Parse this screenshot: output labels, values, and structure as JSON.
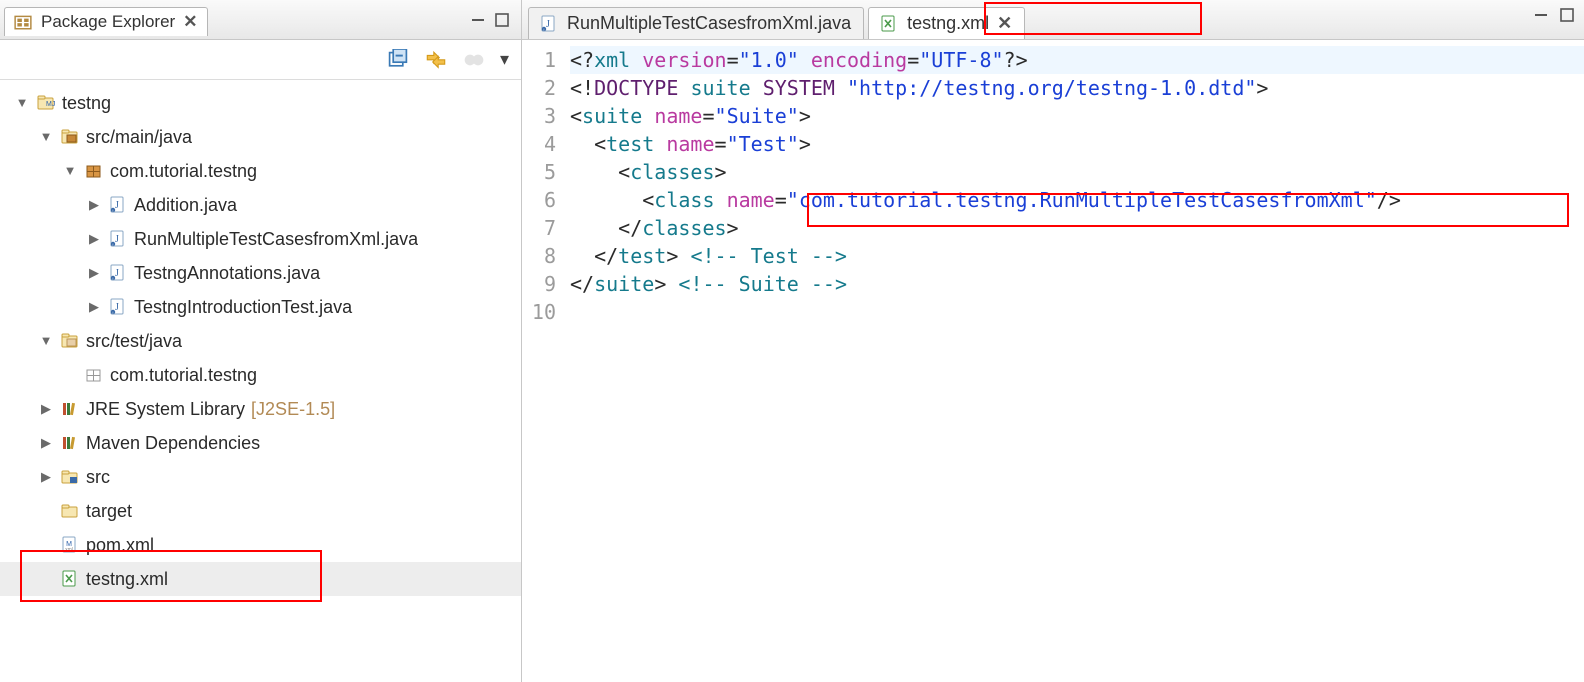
{
  "explorer": {
    "title": "Package Explorer",
    "nodes": [
      {
        "indent": 0,
        "twisty": "down",
        "icon": "project",
        "label": "testng",
        "sel": false
      },
      {
        "indent": 1,
        "twisty": "down",
        "icon": "srcfolder",
        "label": "src/main/java",
        "sel": false
      },
      {
        "indent": 2,
        "twisty": "down",
        "icon": "package",
        "label": "com.tutorial.testng",
        "sel": false
      },
      {
        "indent": 3,
        "twisty": "right",
        "icon": "java",
        "label": "Addition.java",
        "sel": false
      },
      {
        "indent": 3,
        "twisty": "right",
        "icon": "java",
        "label": "RunMultipleTestCasesfromXml.java",
        "sel": false,
        "clip": true
      },
      {
        "indent": 3,
        "twisty": "right",
        "icon": "java",
        "label": "TestngAnnotations.java",
        "sel": false
      },
      {
        "indent": 3,
        "twisty": "right",
        "icon": "java",
        "label": "TestngIntroductionTest.java",
        "sel": false
      },
      {
        "indent": 1,
        "twisty": "down",
        "icon": "srcfolder-w",
        "label": "src/test/java",
        "sel": false
      },
      {
        "indent": 2,
        "twisty": "blank",
        "icon": "package-e",
        "label": "com.tutorial.testng",
        "sel": false
      },
      {
        "indent": 1,
        "twisty": "right",
        "icon": "library",
        "label": "JRE System Library",
        "suffix": "[J2SE-1.5]",
        "sel": false
      },
      {
        "indent": 1,
        "twisty": "right",
        "icon": "library",
        "label": "Maven Dependencies",
        "sel": false
      },
      {
        "indent": 1,
        "twisty": "right",
        "icon": "folder-s",
        "label": "src",
        "sel": false
      },
      {
        "indent": 1,
        "twisty": "blank",
        "icon": "folder",
        "label": "target",
        "sel": false
      },
      {
        "indent": 1,
        "twisty": "blank",
        "icon": "xml-m",
        "label": "pom.xml",
        "sel": false
      },
      {
        "indent": 1,
        "twisty": "blank",
        "icon": "xml-g",
        "label": "testng.xml",
        "sel": true
      }
    ]
  },
  "editor": {
    "tabs": [
      {
        "icon": "java",
        "label": "RunMultipleTestCasesfromXml.java",
        "active": false
      },
      {
        "icon": "xml-g",
        "label": "testng.xml",
        "active": true
      }
    ],
    "code": [
      {
        "n": 1,
        "hl": true,
        "tokens": [
          [
            "t",
            "<?"
          ],
          [
            "pi",
            "xml"
          ],
          [
            "t",
            " "
          ],
          [
            "attr",
            "version"
          ],
          [
            "t",
            "="
          ],
          [
            "str",
            "\"1.0\""
          ],
          [
            "t",
            " "
          ],
          [
            "attr",
            "encoding"
          ],
          [
            "t",
            "="
          ],
          [
            "str",
            "\"UTF-8\""
          ],
          [
            "t",
            "?>"
          ]
        ]
      },
      {
        "n": 2,
        "tokens": [
          [
            "t",
            "<!"
          ],
          [
            "kw",
            "DOCTYPE"
          ],
          [
            "t",
            " "
          ],
          [
            "tag",
            "suite"
          ],
          [
            "t",
            " "
          ],
          [
            "kw",
            "SYSTEM"
          ],
          [
            "t",
            " "
          ],
          [
            "str",
            "\"http://testng.org/testng-1.0.dtd\""
          ],
          [
            "t",
            ">"
          ]
        ]
      },
      {
        "n": 3,
        "tokens": [
          [
            "t",
            "<"
          ],
          [
            "tag",
            "suite"
          ],
          [
            "t",
            " "
          ],
          [
            "attr",
            "name"
          ],
          [
            "t",
            "="
          ],
          [
            "str",
            "\"Suite\""
          ],
          [
            "t",
            ">"
          ]
        ]
      },
      {
        "n": 4,
        "tokens": [
          [
            "t",
            "  <"
          ],
          [
            "tag",
            "test"
          ],
          [
            "t",
            " "
          ],
          [
            "attr",
            "name"
          ],
          [
            "t",
            "="
          ],
          [
            "str",
            "\"Test\""
          ],
          [
            "t",
            ">"
          ]
        ]
      },
      {
        "n": 5,
        "tokens": [
          [
            "t",
            "    <"
          ],
          [
            "tag",
            "classes"
          ],
          [
            "t",
            ">"
          ]
        ]
      },
      {
        "n": 6,
        "tokens": [
          [
            "t",
            "      <"
          ],
          [
            "tag",
            "class"
          ],
          [
            "t",
            " "
          ],
          [
            "attr",
            "name"
          ],
          [
            "t",
            "="
          ],
          [
            "str",
            "\"com.tutorial.testng.RunMultipleTestCasesfromXml\""
          ],
          [
            "t",
            "/>"
          ]
        ]
      },
      {
        "n": 7,
        "tokens": [
          [
            "t",
            "    </"
          ],
          [
            "tag",
            "classes"
          ],
          [
            "t",
            ">"
          ]
        ]
      },
      {
        "n": 8,
        "tokens": [
          [
            "t",
            "  </"
          ],
          [
            "tag",
            "test"
          ],
          [
            "t",
            "> "
          ],
          [
            "cmt",
            "<!-- Test -->"
          ]
        ]
      },
      {
        "n": 9,
        "tokens": [
          [
            "t",
            "</"
          ],
          [
            "tag",
            "suite"
          ],
          [
            "t",
            "> "
          ],
          [
            "cmt",
            "<!-- Suite -->"
          ]
        ]
      },
      {
        "n": 10,
        "tokens": [
          [
            "t",
            ""
          ]
        ]
      }
    ]
  }
}
